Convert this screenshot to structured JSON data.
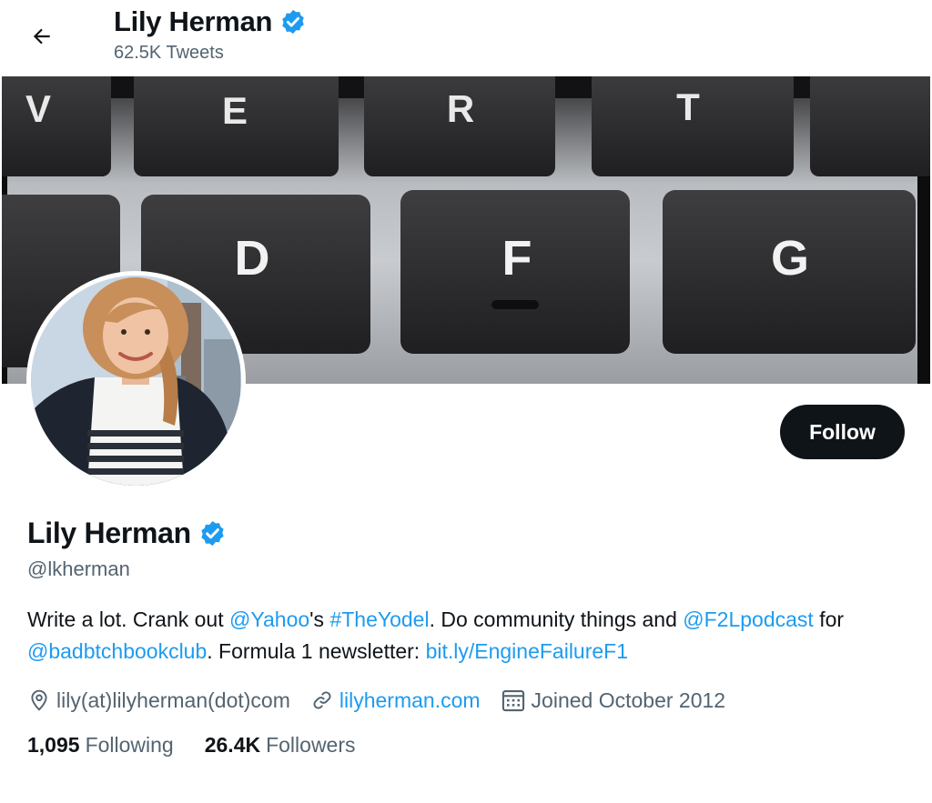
{
  "header": {
    "name": "Lily Herman",
    "tweet_count": "62.5K Tweets"
  },
  "banner": {
    "keys_top": [
      "V",
      "E",
      "R",
      "T",
      ""
    ],
    "keys_bottom": [
      "",
      "D",
      "F",
      "G"
    ]
  },
  "profile": {
    "name": "Lily Herman",
    "handle": "@lkherman",
    "follow_label": "Follow",
    "bio": {
      "t1": "Write a lot. Crank out ",
      "l1": "@Yahoo",
      "t2": "'s ",
      "l2": "#TheYodel",
      "t3": ". Do community things and ",
      "l3": "@F2Lpodcast",
      "t4": " for ",
      "l4": "@badbtchbookclub",
      "t5": ". Formula 1 newsletter: ",
      "l5": "bit.ly/EngineFailureF1"
    },
    "location": "lily(at)lilyherman(dot)com",
    "website": "lilyherman.com",
    "joined": "Joined October 2012",
    "following_count": "1,095",
    "following_label": "Following",
    "followers_count": "26.4K",
    "followers_label": "Followers"
  },
  "icons": {
    "back": "arrow-left-icon",
    "verified": "verified-badge-icon",
    "location": "location-pin-icon",
    "link": "link-icon",
    "calendar": "calendar-icon"
  },
  "colors": {
    "accent": "#1d9bf0",
    "text": "#0f1419",
    "muted": "#536471",
    "button": "#0f1419"
  }
}
